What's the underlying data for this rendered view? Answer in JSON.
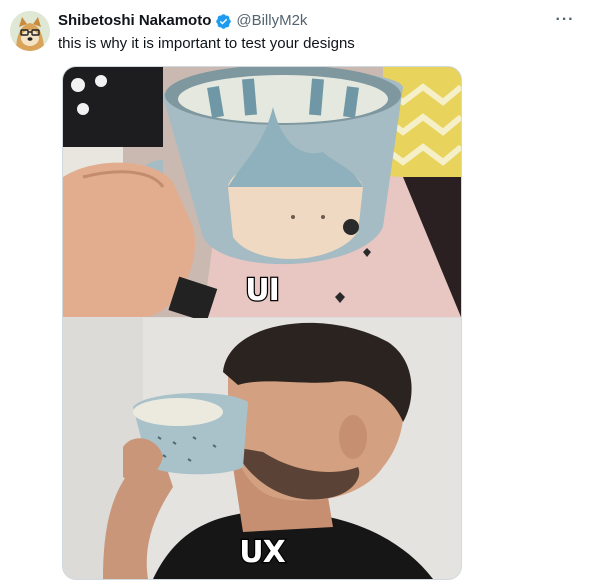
{
  "tweet": {
    "author_name": "Shibetoshi Nakamoto",
    "handle": "@BillyM2k",
    "text": "this is why it is important to test your designs",
    "more_label": "···"
  },
  "media": {
    "top_caption": "UI",
    "bottom_caption": "UX"
  },
  "colors": {
    "verified": "#1d9bf0",
    "handle": "#536471",
    "border": "#cfd9de"
  }
}
